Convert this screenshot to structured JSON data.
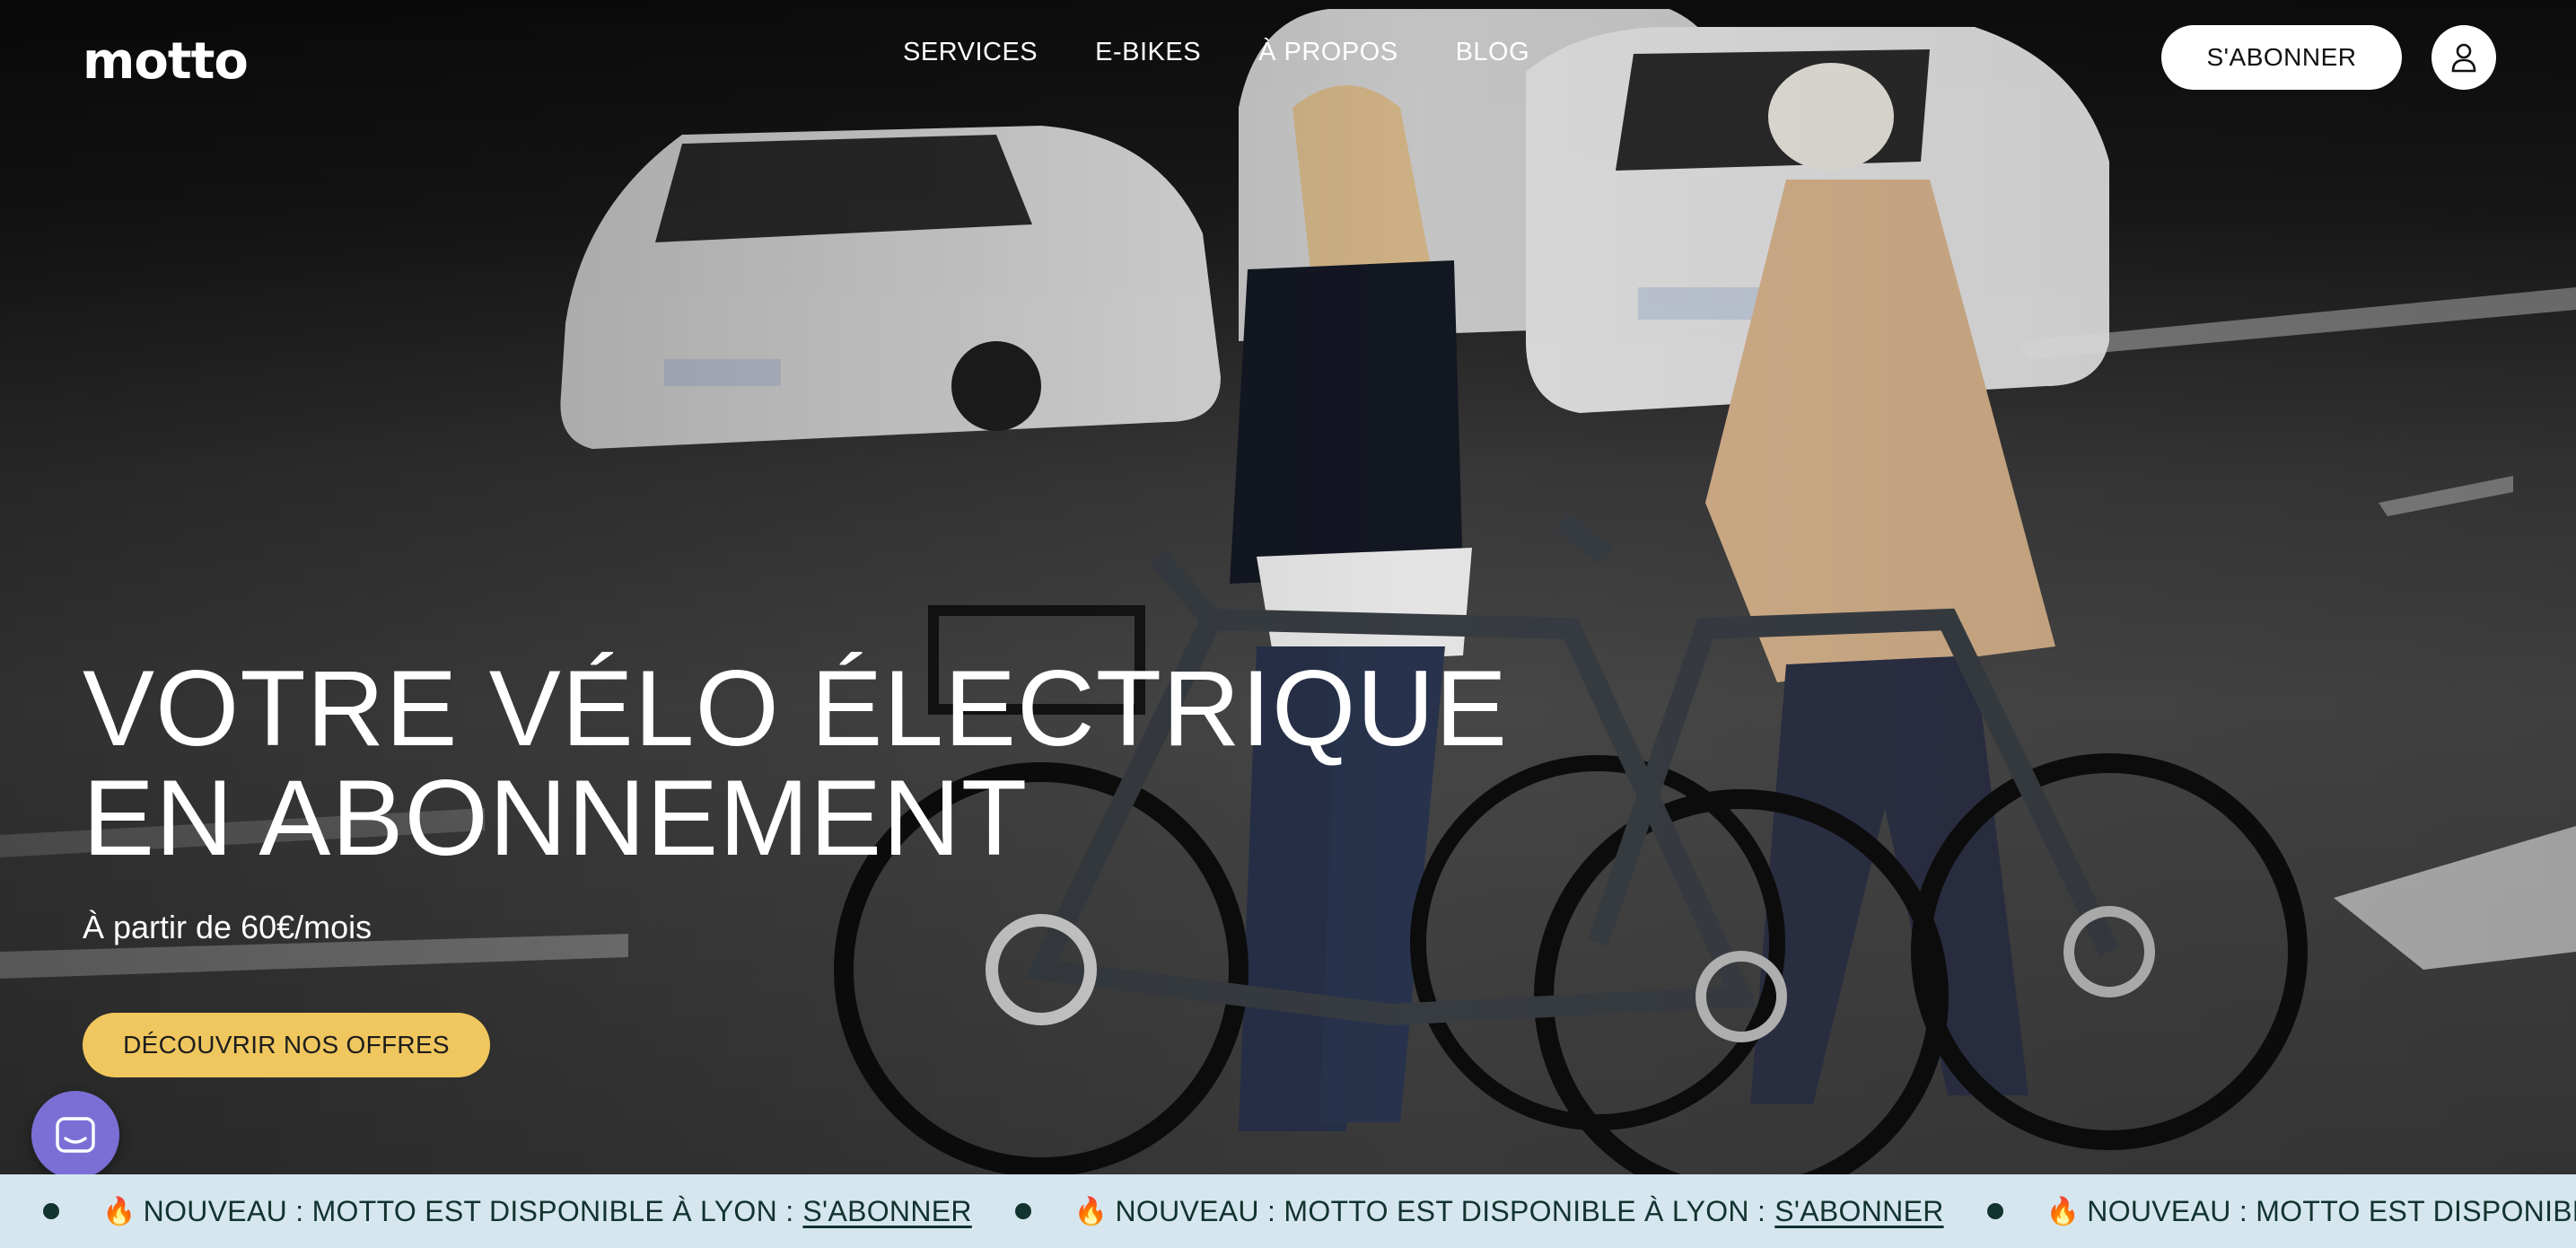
{
  "brand": {
    "logo": "motto"
  },
  "nav": {
    "items": [
      "SERVICES",
      "E-BIKES",
      "À PROPOS",
      "BLOG"
    ]
  },
  "header": {
    "subscribe_label": "S'ABONNER",
    "account_icon": "user-icon"
  },
  "hero": {
    "headline_line1": "VOTRE VÉLO ÉLECTRIQUE",
    "headline_line2": "EN ABONNEMENT",
    "subline": "À partir de 60€/mois",
    "cta_label": "DÉCOUVRIR NOS OFFRES"
  },
  "chat": {
    "icon": "chat-icon"
  },
  "ticker": {
    "emoji": "🔥",
    "text": "NOUVEAU : MOTTO EST DISPONIBLE À LYON :",
    "link_label": "S'ABONNER"
  },
  "colors": {
    "cta": "#f0c75e",
    "ticker_bg": "#d6e6ee",
    "ticker_text": "#12332f",
    "chat": "#7b6fd6"
  }
}
